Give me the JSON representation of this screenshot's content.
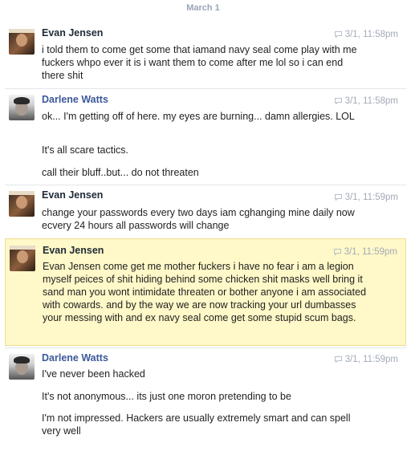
{
  "date_header": "March 1",
  "messages": [
    {
      "sender": "Evan Jensen",
      "timestamp": "3/1, 11:58pm",
      "paragraphs": [
        "i told them to come get some that iamand navy seal come play with me fuckers whpo ever it is i want them to come after me lol so i can end there shit"
      ]
    },
    {
      "sender": "Darlene Watts",
      "timestamp": "3/1, 11:58pm",
      "paragraphs": [
        "ok... I'm getting off of here.  my eyes are burning...  damn allergies. LOL",
        "It's all scare tactics.",
        "call their bluff..but... do not threaten"
      ]
    },
    {
      "sender": "Evan Jensen",
      "timestamp": "3/1, 11:59pm",
      "paragraphs": [
        "change your passwords every two days iam cghanging mine daily now ecvery 24 hours all passwords will change"
      ]
    },
    {
      "sender": "Evan Jensen",
      "timestamp": "3/1, 11:59pm",
      "highlighted": true,
      "paragraphs": [
        "Evan Jensen come get me mother fuckers i have no fear i am a legion myself peices of shit hiding behind some chicken shit masks well bring it sand man you wont intimidate threaten or bother anyone i am associated with cowards. and by the way we are now tracking your url dumbasses your messing with and ex navy seal come get some stupid scum bags."
      ]
    },
    {
      "sender": "Darlene Watts",
      "timestamp": "3/1, 11:59pm",
      "paragraphs": [
        "I've never been hacked",
        "It's not anonymous... its just one moron pretending to be",
        "I'm not impressed.  Hackers are usually extremely smart and can spell very well"
      ]
    }
  ]
}
